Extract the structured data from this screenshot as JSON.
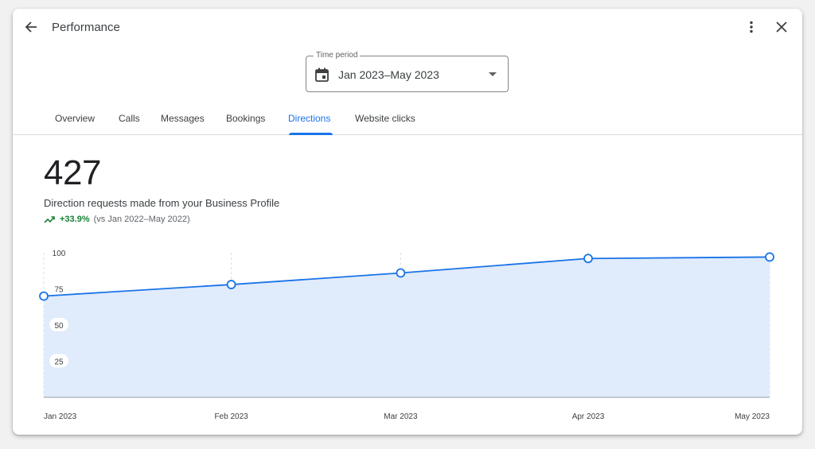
{
  "dialog": {
    "title": "Performance"
  },
  "time_period": {
    "label": "Time period",
    "value": "Jan 2023–May 2023"
  },
  "tabs": [
    {
      "label": "Overview",
      "active": false
    },
    {
      "label": "Calls",
      "active": false
    },
    {
      "label": "Messages",
      "active": false
    },
    {
      "label": "Bookings",
      "active": false
    },
    {
      "label": "Directions",
      "active": true
    },
    {
      "label": "Website clicks",
      "active": false
    }
  ],
  "summary": {
    "total": "427",
    "description": "Direction requests made from your Business Profile",
    "change": "+33.9%",
    "comparison": "(vs Jan 2022–May 2022)"
  },
  "colors": {
    "accent": "#1a73e8",
    "positive": "#188038",
    "area_fill": "#e0ebfb"
  },
  "icons": [
    "back-arrow-icon",
    "more-vert-icon",
    "close-icon",
    "calendar-icon",
    "dropdown-arrow-icon",
    "trending-up-icon"
  ],
  "chart_data": {
    "type": "area",
    "categories": [
      "Jan 2023",
      "Feb 2023",
      "Mar 2023",
      "Apr 2023",
      "May 2023"
    ],
    "x_positions": [
      0,
      31,
      59,
      90,
      120
    ],
    "series": [
      {
        "values": [
          70,
          78,
          86,
          96,
          97
        ]
      }
    ],
    "yticks": [
      25,
      50,
      75,
      100
    ],
    "ylim": [
      0,
      100
    ],
    "grid": "vertical-dashed",
    "title": "",
    "xlabel": "",
    "ylabel": ""
  }
}
